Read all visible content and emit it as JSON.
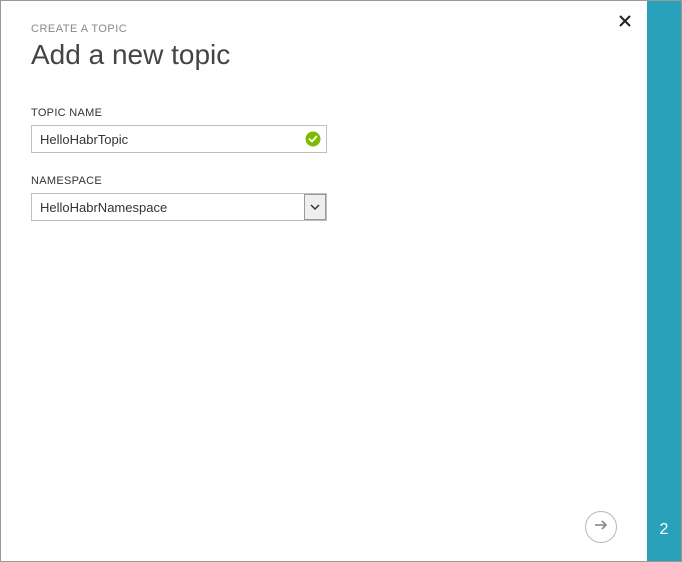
{
  "breadcrumb": "CREATE A TOPIC",
  "title": "Add a new topic",
  "topicName": {
    "label": "TOPIC NAME",
    "value": "HelloHabrTopic"
  },
  "namespace": {
    "label": "NAMESPACE",
    "value": "HelloHabrNamespace"
  },
  "stepNumber": "2"
}
